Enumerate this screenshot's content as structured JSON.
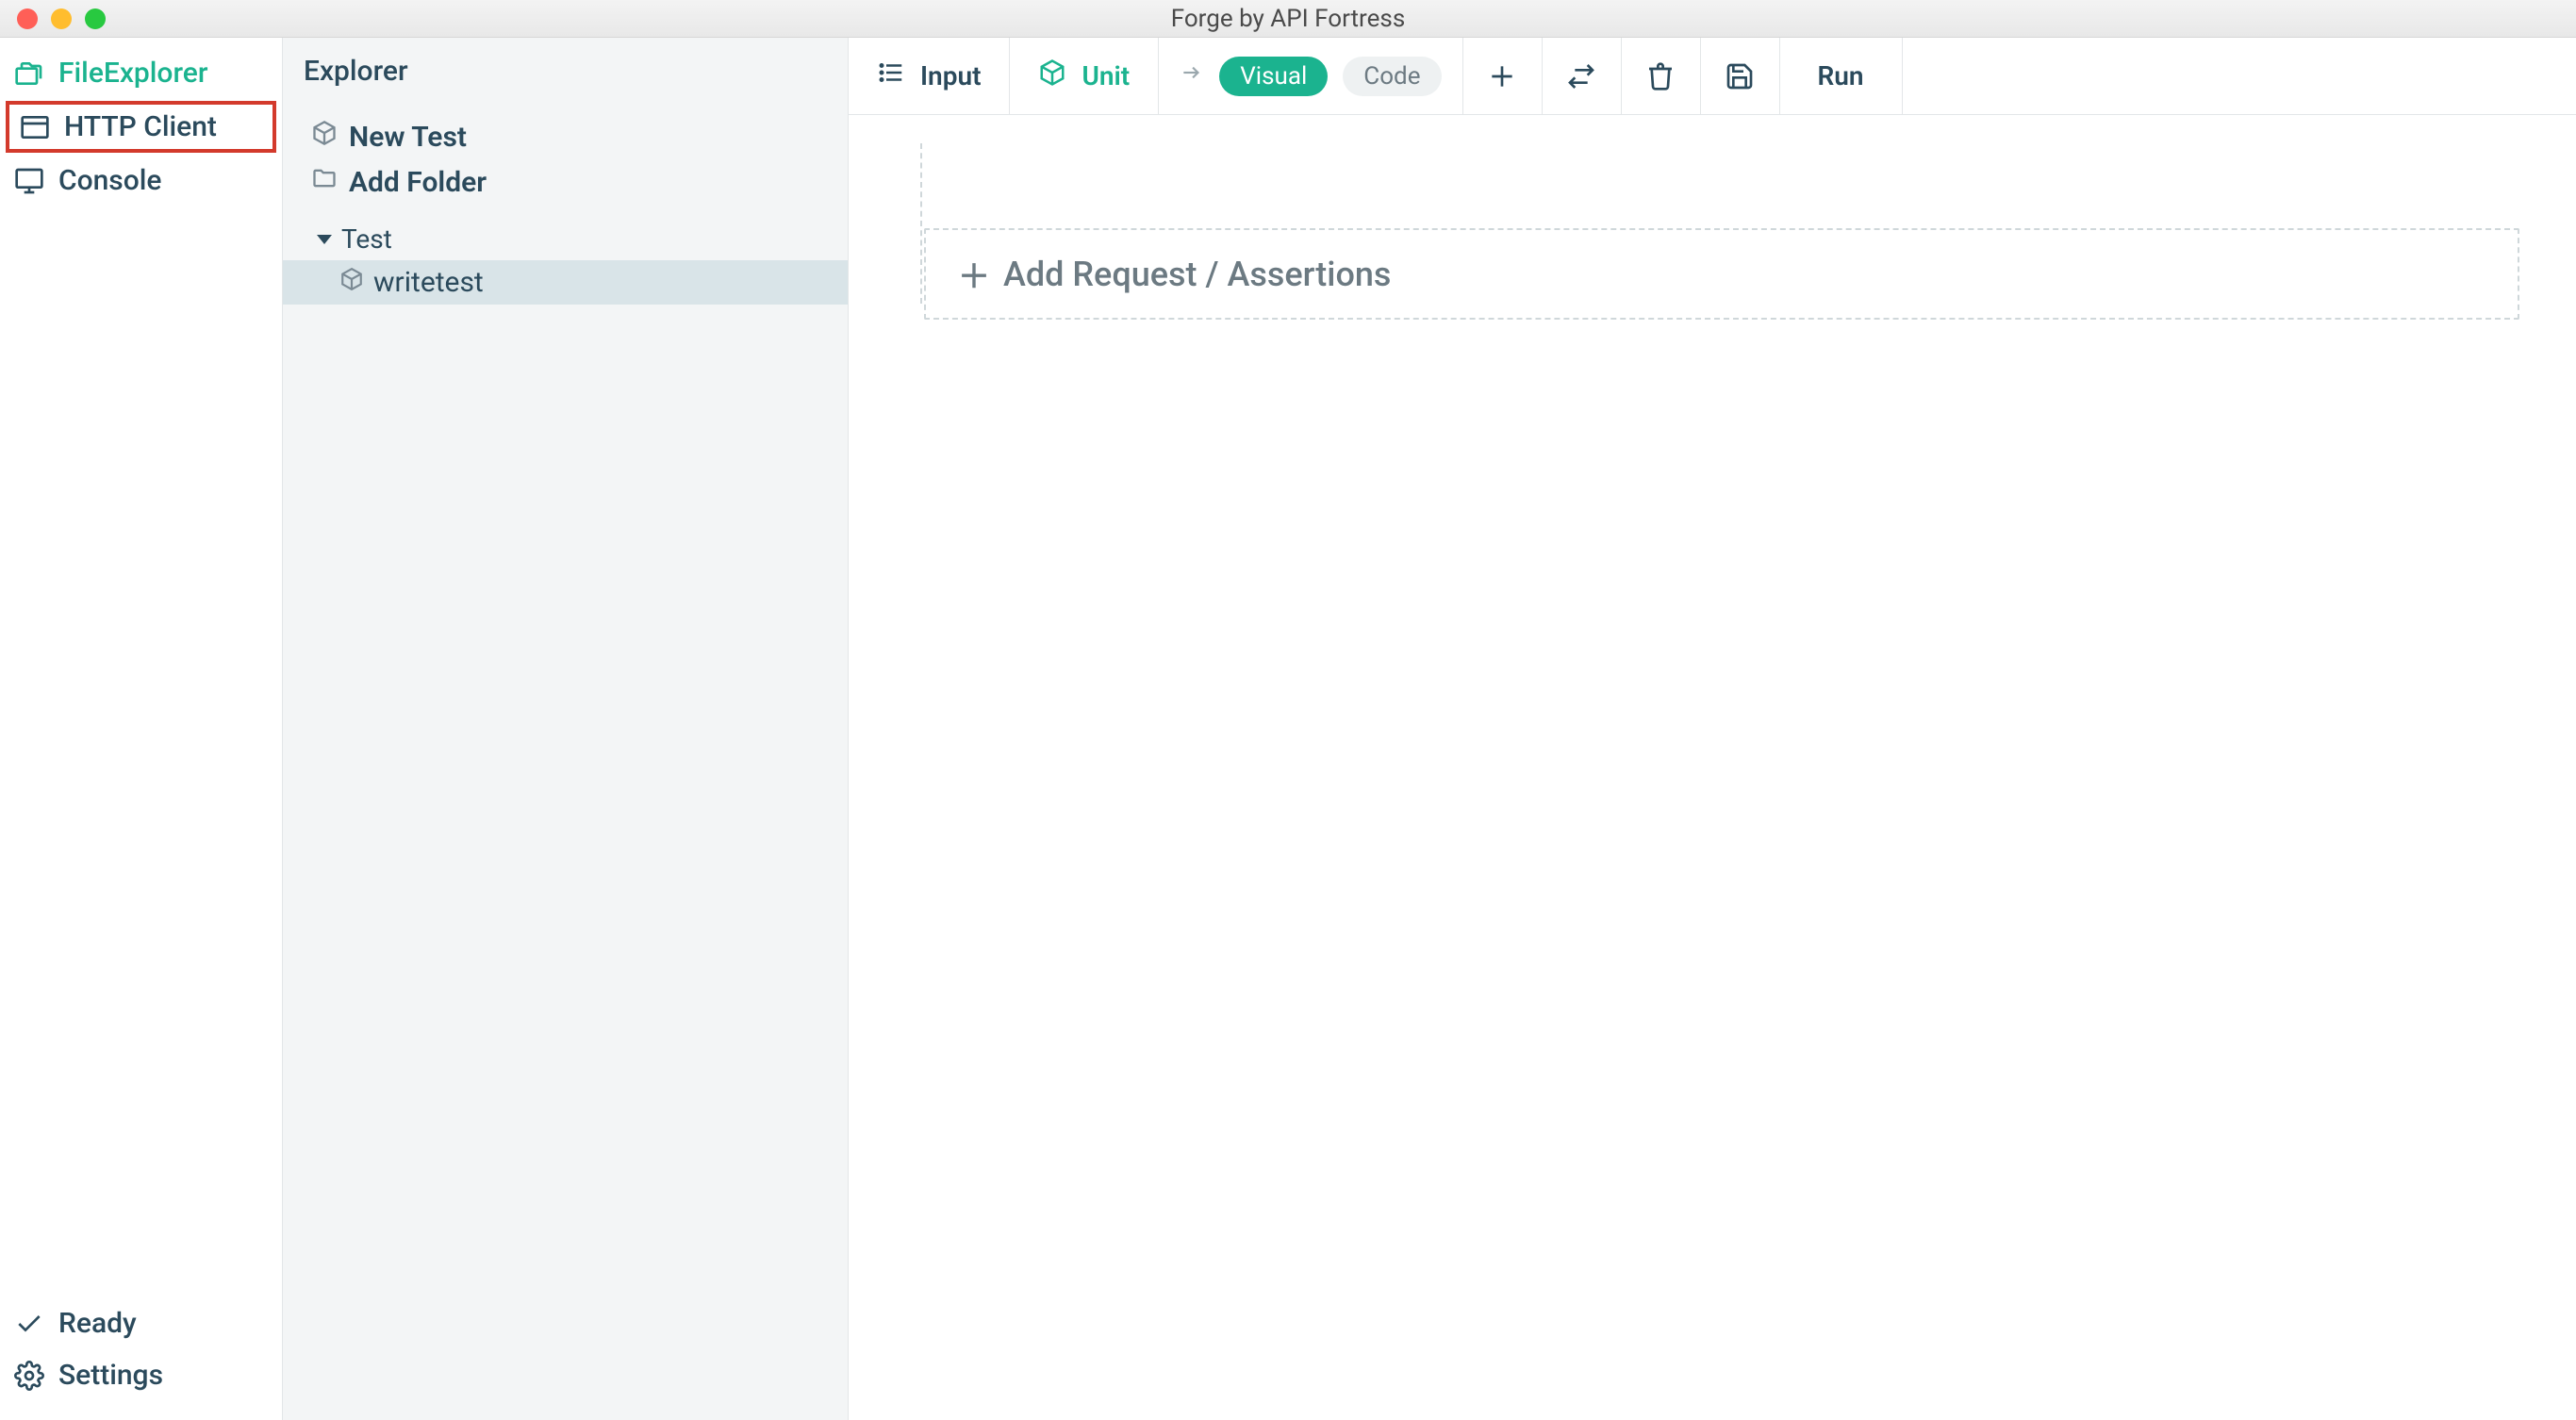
{
  "window": {
    "title": "Forge by API Fortress"
  },
  "rail": {
    "items": [
      {
        "id": "file-explorer",
        "label": "FileExplorer",
        "icon": "folders-icon",
        "active": true
      },
      {
        "id": "http-client",
        "label": "HTTP Client",
        "icon": "window-icon",
        "highlight": true
      },
      {
        "id": "console",
        "label": "Console",
        "icon": "monitor-icon"
      }
    ],
    "status": {
      "label": "Ready",
      "icon": "check-icon"
    },
    "settings": {
      "label": "Settings",
      "icon": "gear-icon"
    }
  },
  "explorer": {
    "title": "Explorer",
    "actions": {
      "new_test": "New Test",
      "add_folder": "Add Folder"
    },
    "tree": {
      "folder": {
        "name": "Test"
      },
      "item": {
        "name": "writetest"
      }
    }
  },
  "toolbar": {
    "input": {
      "label": "Input"
    },
    "unit": {
      "label": "Unit"
    },
    "view": {
      "visual": "Visual",
      "code": "Code"
    },
    "run": {
      "label": "Run"
    }
  },
  "canvas": {
    "add_label": "Add Request / Assertions"
  }
}
